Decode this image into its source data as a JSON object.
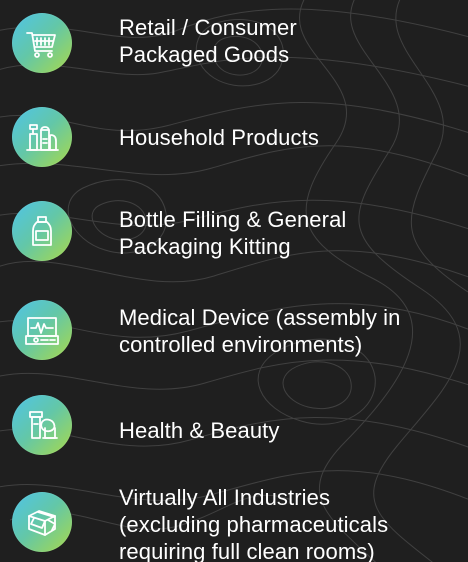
{
  "industries": [
    {
      "lines": [
        "Retail / Consumer",
        "Packaged Goods"
      ],
      "icon": "shopping-cart-icon"
    },
    {
      "lines": [
        "Household Products"
      ],
      "icon": "cleaning-products-icon"
    },
    {
      "lines": [
        "Bottle Filling & General",
        "Packaging Kitting"
      ],
      "icon": "bottle-icon"
    },
    {
      "lines": [
        "Medical Device (assembly in",
        "controlled environments)"
      ],
      "icon": "heart-monitor-icon"
    },
    {
      "lines": [
        "Health & Beauty"
      ],
      "icon": "beauty-products-icon"
    },
    {
      "lines": [
        "Virtually All Industries",
        "(excluding pharmaceuticals",
        "requiring full clean rooms)"
      ],
      "icon": "boxes-icon"
    }
  ],
  "colors": {
    "background": "#1f1f1f",
    "text": "#ffffff",
    "badge_gradient_start": "#4fc4e8",
    "badge_gradient_mid": "#63c7a7",
    "badge_gradient_end": "#a9d94a"
  }
}
